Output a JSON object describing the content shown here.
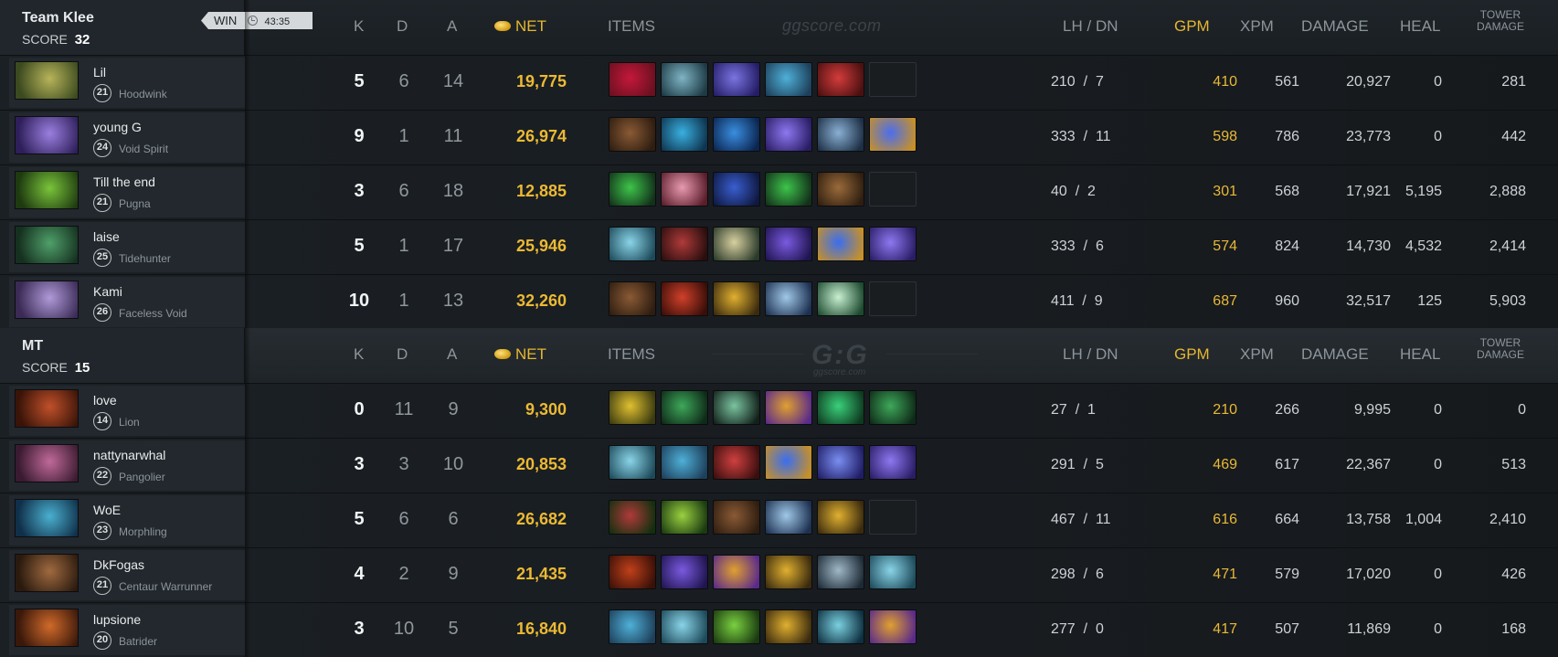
{
  "headers": {
    "k": "K",
    "d": "D",
    "a": "A",
    "net": "NET",
    "items": "ITEMS",
    "lh": "LH",
    "slash": "/",
    "dn": "DN",
    "gpm": "GPM",
    "xpm": "XPM",
    "damage": "DAMAGE",
    "heal": "HEAL",
    "tower_line1": "TOWER",
    "tower_line2": "DAMAGE"
  },
  "watermark": {
    "site": "ggscore.com",
    "logo": "G:G",
    "logo_sub": "ggscore.com"
  },
  "teams": [
    {
      "name": "Team Klee",
      "score_label": "SCORE",
      "score": "32",
      "result": "WIN",
      "duration": "43:35",
      "players": [
        {
          "name": "Lil",
          "level": "21",
          "hero": "Hoodwink",
          "k": "5",
          "d": "6",
          "a": "14",
          "net": "19,775",
          "lh": "210",
          "dn": "7",
          "gpm": "410",
          "xpm": "561",
          "damage": "20,927",
          "heal": "0",
          "tower": "281",
          "portrait": [
            "#b7b45a",
            "#3c4a1f"
          ],
          "items": [
            [
              "#c4183a",
              "#6a1020"
            ],
            [
              "#7fb4c4",
              "#1d3a45"
            ],
            [
              "#7a74e0",
              "#241d66"
            ],
            [
              "#4fb0d8",
              "#1d3f5a"
            ],
            [
              "#d43b3b",
              "#4a1010"
            ],
            null
          ]
        },
        {
          "name": "young G",
          "level": "24",
          "hero": "Void Spirit",
          "k": "9",
          "d": "1",
          "a": "11",
          "net": "26,974",
          "lh": "333",
          "dn": "11",
          "gpm": "598",
          "xpm": "786",
          "damage": "23,773",
          "heal": "0",
          "tower": "442",
          "portrait": [
            "#9b7fe0",
            "#2e1f5a"
          ],
          "items": [
            [
              "#8a5a35",
              "#2e1d10"
            ],
            [
              "#3ab0e0",
              "#0e3550"
            ],
            [
              "#3a8ee0",
              "#0b2550"
            ],
            [
              "#8e78f0",
              "#2a1d66"
            ],
            [
              "#8ab0d4",
              "#1d2f45"
            ],
            [
              "#4a6ef0",
              "#c79028"
            ]
          ]
        },
        {
          "name": "Till the end",
          "level": "21",
          "hero": "Pugna",
          "k": "3",
          "d": "6",
          "a": "18",
          "net": "12,885",
          "lh": "40",
          "dn": "2",
          "gpm": "301",
          "xpm": "568",
          "damage": "17,921",
          "heal": "5,195",
          "tower": "2,888",
          "portrait": [
            "#7ac43a",
            "#1e3a10"
          ],
          "items": [
            [
              "#3ec44a",
              "#12301a"
            ],
            [
              "#e89ab0",
              "#5a1d2a"
            ],
            [
              "#3a5ed0",
              "#0e1840"
            ],
            [
              "#3ec44a",
              "#12301a"
            ],
            [
              "#9a6a3a",
              "#2e1e10"
            ],
            null
          ]
        },
        {
          "name": "laise",
          "level": "25",
          "hero": "Tidehunter",
          "k": "5",
          "d": "1",
          "a": "17",
          "net": "25,946",
          "lh": "333",
          "dn": "6",
          "gpm": "574",
          "xpm": "824",
          "damage": "14,730",
          "heal": "4,532",
          "tower": "2,414",
          "portrait": [
            "#4fa06a",
            "#15301f"
          ],
          "items": [
            [
              "#8ad4e8",
              "#1d4a5a"
            ],
            [
              "#b03a3a",
              "#2a0e0e"
            ],
            [
              "#d8d0a0",
              "#2a3a2a"
            ],
            [
              "#7a5ae0",
              "#201550"
            ],
            [
              "#3a6ef0",
              "#c79028"
            ],
            [
              "#8e78f0",
              "#2a1d66"
            ]
          ]
        },
        {
          "name": "Kami",
          "level": "26",
          "hero": "Faceless Void",
          "k": "10",
          "d": "1",
          "a": "13",
          "net": "32,260",
          "lh": "411",
          "dn": "9",
          "gpm": "687",
          "xpm": "960",
          "damage": "32,517",
          "heal": "125",
          "tower": "5,903",
          "portrait": [
            "#b09ad8",
            "#3a2a55"
          ],
          "items": [
            [
              "#8a5a35",
              "#2e1d10"
            ],
            [
              "#d0402a",
              "#3a0e08"
            ],
            [
              "#e0b030",
              "#3a2a0e"
            ],
            [
              "#a0c8e8",
              "#1d3050"
            ],
            [
              "#c8f0d0",
              "#1d4a30"
            ],
            null
          ]
        }
      ]
    },
    {
      "name": "MT",
      "score_label": "SCORE",
      "score": "15",
      "players": [
        {
          "name": "love",
          "level": "14",
          "hero": "Lion",
          "k": "0",
          "d": "11",
          "a": "9",
          "net": "9,300",
          "lh": "27",
          "dn": "1",
          "gpm": "210",
          "xpm": "266",
          "damage": "9,995",
          "heal": "0",
          "tower": "0",
          "portrait": [
            "#c0502a",
            "#3a1408"
          ],
          "items": [
            [
              "#e0c030",
              "#3a3a10"
            ],
            [
              "#3ea85a",
              "#0e2a18"
            ],
            [
              "#7ac4a0",
              "#12201a"
            ],
            [
              "#e0a030",
              "#5a2a8a"
            ],
            [
              "#3ad07a",
              "#0e3a20"
            ],
            [
              "#3ea85a",
              "#0e2a18"
            ]
          ]
        },
        {
          "name": "nattynarwhal",
          "level": "22",
          "hero": "Pangolier",
          "k": "3",
          "d": "3",
          "a": "10",
          "net": "20,853",
          "lh": "291",
          "dn": "5",
          "gpm": "469",
          "xpm": "617",
          "damage": "22,367",
          "heal": "0",
          "tower": "513",
          "portrait": [
            "#c06a9a",
            "#3a1a30"
          ],
          "items": [
            [
              "#8ad4e8",
              "#1d4a5a"
            ],
            [
              "#4fb0d8",
              "#1d3f5a"
            ],
            [
              "#d04040",
              "#3a0e0e"
            ],
            [
              "#3a6ef0",
              "#c79028"
            ],
            [
              "#7a8ef0",
              "#201d66"
            ],
            [
              "#8e78f0",
              "#2a1d66"
            ]
          ]
        },
        {
          "name": "WoE",
          "level": "23",
          "hero": "Morphling",
          "k": "5",
          "d": "6",
          "a": "6",
          "net": "26,682",
          "lh": "467",
          "dn": "11",
          "gpm": "616",
          "xpm": "664",
          "damage": "13,758",
          "heal": "1,004",
          "tower": "2,410",
          "portrait": [
            "#4ab0d0",
            "#10304a"
          ],
          "items": [
            [
              "#b03a3a",
              "#12300e"
            ],
            [
              "#9ad040",
              "#1a3a10"
            ],
            [
              "#8a5a35",
              "#2e1d10"
            ],
            [
              "#a0c8e8",
              "#1d3050"
            ],
            [
              "#e0b030",
              "#3a2a0e"
            ],
            null
          ]
        },
        {
          "name": "DkFogas",
          "level": "21",
          "hero": "Centaur Warrunner",
          "k": "4",
          "d": "2",
          "a": "9",
          "net": "21,435",
          "lh": "298",
          "dn": "6",
          "gpm": "471",
          "xpm": "579",
          "damage": "17,020",
          "heal": "0",
          "tower": "426",
          "portrait": [
            "#a06a40",
            "#2a1a0e"
          ],
          "items": [
            [
              "#c0401a",
              "#3a1008"
            ],
            [
              "#7a5ae0",
              "#201550"
            ],
            [
              "#e0a030",
              "#5a2a8a"
            ],
            [
              "#e0b030",
              "#3a2a0e"
            ],
            [
              "#a0b8c8",
              "#1d2a35"
            ],
            [
              "#8ad4e8",
              "#1d4a5a"
            ]
          ]
        },
        {
          "name": "lupsione",
          "level": "20",
          "hero": "Batrider",
          "k": "3",
          "d": "10",
          "a": "5",
          "net": "16,840",
          "lh": "277",
          "dn": "0",
          "gpm": "417",
          "xpm": "507",
          "damage": "11,869",
          "heal": "0",
          "tower": "168",
          "portrait": [
            "#d06a2a",
            "#3a180a"
          ],
          "items": [
            [
              "#4fb0d8",
              "#1d3f5a"
            ],
            [
              "#8ad4e8",
              "#1d4a5a"
            ],
            [
              "#7ad040",
              "#1a3a10"
            ],
            [
              "#e0b030",
              "#3a2a0e"
            ],
            [
              "#7ad0e0",
              "#0e3040"
            ],
            [
              "#e0a030",
              "#5a2a8a"
            ]
          ]
        }
      ]
    }
  ]
}
